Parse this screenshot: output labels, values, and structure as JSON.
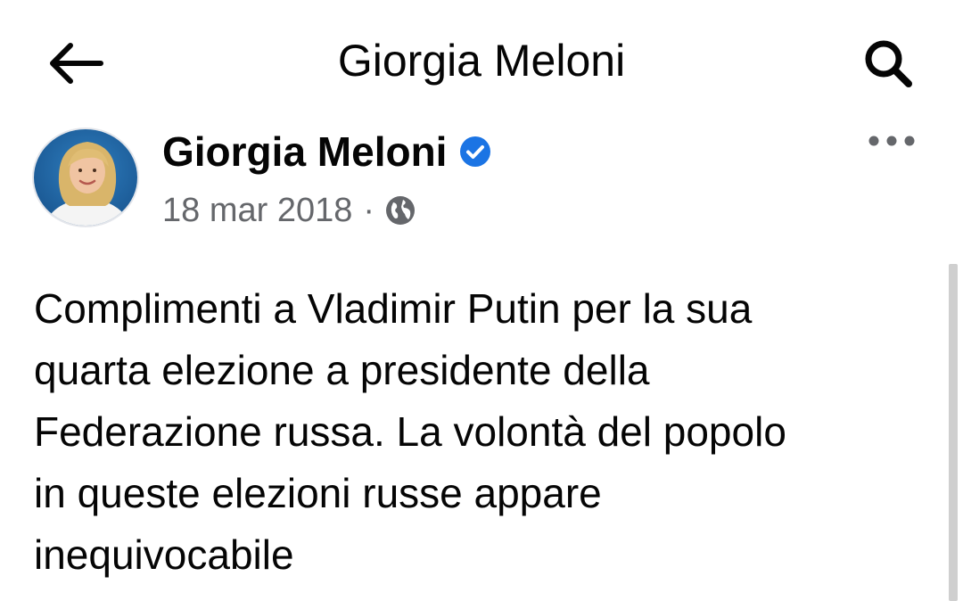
{
  "header": {
    "title": "Giorgia Meloni",
    "back_icon": "arrow-left-icon",
    "search_icon": "search-icon"
  },
  "post": {
    "author": "Giorgia Meloni",
    "verified_icon": "verified-badge-icon",
    "date": "18 mar 2018",
    "separator": "·",
    "audience_icon": "globe-icon",
    "more_icon": "more-horizontal-icon",
    "text": "Complimenti a Vladimir Putin per la sua\nquarta elezione a presidente della\nFederazione russa. La volontà del popolo\nin queste elezioni russe appare\ninequivocabile"
  },
  "colors": {
    "text": "#050505",
    "secondary_text": "#65676b",
    "verified_blue": "#1b74e4",
    "scrollbar": "#cfcfcf"
  }
}
